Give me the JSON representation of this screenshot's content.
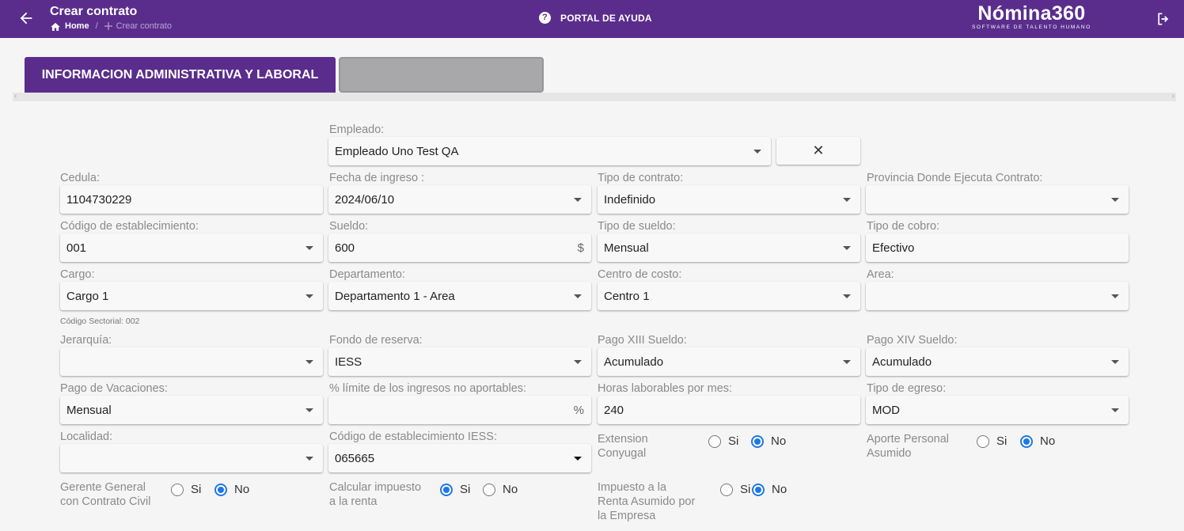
{
  "header": {
    "title": "Crear contrato",
    "breadcrumb_home": "Home",
    "breadcrumb_current": "Crear contrato",
    "help_label": "PORTAL DE AYUDA",
    "logo_brand": "Nómina360",
    "logo_tagline": "SOFTWARE DE TALENTO HUMANO"
  },
  "tabs": {
    "active_label": "INFORMACION ADMINISTRATIVA Y LABORAL",
    "inactive_label": ""
  },
  "colors": {
    "primary": "#5a2d8c",
    "radio_selected": "#1e78e6"
  },
  "form": {
    "empleado": {
      "label": "Empleado:",
      "value": "Empleado Uno Test QA"
    },
    "clear_glyph": "✕",
    "cedula": {
      "label": "Cedula:",
      "value": "1104730229"
    },
    "fecha_ingreso": {
      "label": "Fecha de ingreso :",
      "value": "2024/06/10"
    },
    "tipo_contrato": {
      "label": "Tipo de contrato:",
      "value": "Indefinido"
    },
    "provincia": {
      "label": "Provincia Donde Ejecuta Contrato:",
      "value": ""
    },
    "codigo_establecimiento": {
      "label": "Código de establecimiento:",
      "value": "001"
    },
    "sueldo": {
      "label": "Sueldo:",
      "value": "600",
      "suffix": "$"
    },
    "tipo_sueldo": {
      "label": "Tipo de sueldo:",
      "value": "Mensual"
    },
    "tipo_cobro": {
      "label": "Tipo de cobro:",
      "value": "Efectivo"
    },
    "cargo": {
      "label": "Cargo:",
      "value": "Cargo 1",
      "helper": "Código Sectorial: 002"
    },
    "departamento": {
      "label": "Departamento:",
      "value": "Departamento 1 - Area"
    },
    "centro_costo": {
      "label": "Centro de costo:",
      "value": "Centro 1"
    },
    "area": {
      "label": "Area:",
      "value": ""
    },
    "jerarquia": {
      "label": "Jerarquía:",
      "value": ""
    },
    "fondo_reserva": {
      "label": "Fondo de reserva:",
      "value": "IESS"
    },
    "pago_xiii": {
      "label": "Pago XIII Sueldo:",
      "value": "Acumulado"
    },
    "pago_xiv": {
      "label": "Pago XIV Sueldo:",
      "value": "Acumulado"
    },
    "pago_vacaciones": {
      "label": "Pago de Vacaciones:",
      "value": "Mensual"
    },
    "limite_ingresos": {
      "label": "% límite de los ingresos no aportables:",
      "value": "",
      "suffix": "%"
    },
    "horas_laborables": {
      "label": "Horas laborables por mes:",
      "value": "240"
    },
    "tipo_egreso": {
      "label": "Tipo de egreso:",
      "value": "MOD"
    },
    "localidad": {
      "label": "Localidad:",
      "value": ""
    },
    "codigo_iess": {
      "label": "Código de establecimiento IESS:",
      "value": "065665"
    },
    "extension_conyugal": {
      "label_line1": "Extension",
      "label_line2": "Conyugal",
      "selected": "No"
    },
    "aporte_personal": {
      "label_line1": "Aporte Personal",
      "label_line2": "Asumido",
      "selected": "No"
    },
    "gerente_general": {
      "label_line1": "Gerente General",
      "label_line2": "con Contrato Civil",
      "selected": "No"
    },
    "calcular_impuesto": {
      "label_line1": "Calcular impuesto",
      "label_line2": "a la renta",
      "selected": "Si"
    },
    "impuesto_asumido": {
      "label_line1": "Impuesto a la",
      "label_line2": "Renta Asumido por",
      "label_line3": "la Empresa",
      "selected": "No"
    },
    "option_si": "Si",
    "option_no": "No"
  }
}
